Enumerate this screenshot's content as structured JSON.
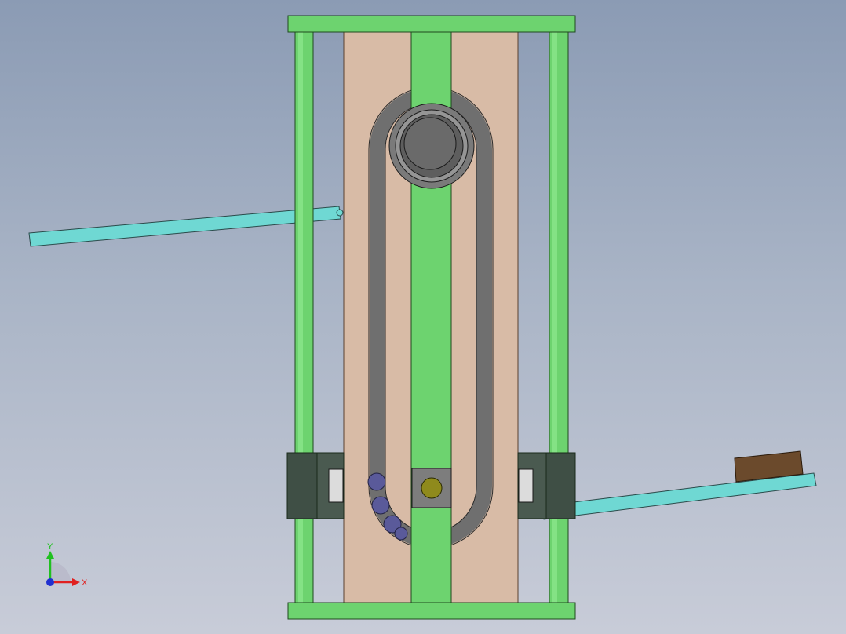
{
  "view": {
    "background_top": "#8b9bb4",
    "background_bottom": "#c8ccd8"
  },
  "colors": {
    "frame_green": "#6dd36f",
    "plate_tan": "#d8bba6",
    "track_gray": "#6f6f6f",
    "rod_cyan": "#6fd8d3",
    "bracket_dark": "#4a5a50",
    "block_brown": "#6b4a2c",
    "pin_olive": "#8f8a1c",
    "ball_purple": "#5a5a9a"
  },
  "triad": {
    "x_label": "X",
    "y_label": "Y",
    "x_color": "#e02020",
    "y_color": "#20c020",
    "z_color": "#2030d0"
  }
}
